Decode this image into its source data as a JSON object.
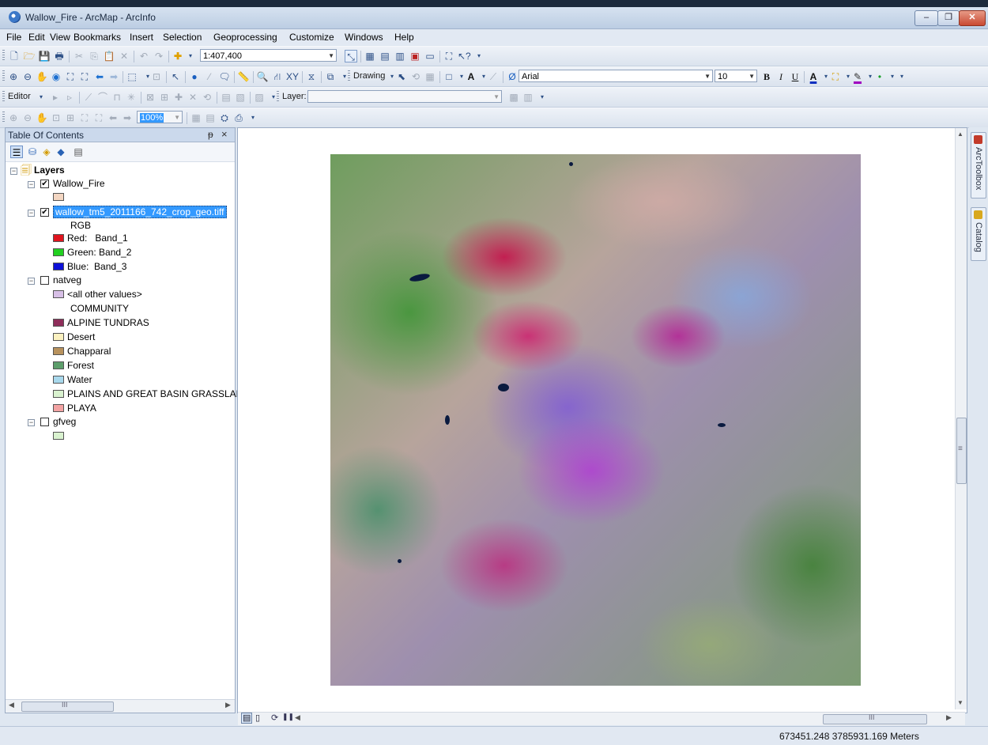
{
  "window": {
    "title": "Wallow_Fire - ArcMap - ArcInfo",
    "controls": {
      "minimize": "–",
      "maximize": "❐",
      "close": "✕"
    }
  },
  "menu": [
    "File",
    "Edit",
    "View",
    "Bookmarks",
    "Insert",
    "Selection",
    "Geoprocessing",
    "Customize",
    "Windows",
    "Help"
  ],
  "toolbar": {
    "scale": "1:407,400",
    "drawing_label": "Drawing",
    "font_name": "Arial",
    "font_size": "10",
    "bold": "B",
    "italic": "I",
    "underline": "U",
    "text_color_glyph": "A",
    "editor_label": "Editor",
    "layer_label": "Layer:",
    "layer_value": "",
    "zoom_percent": "100%"
  },
  "toc": {
    "title": "Table Of Contents",
    "pin": "ᵽ",
    "close": "×",
    "root_label": "Layers",
    "layers": [
      {
        "name": "Wallow_Fire",
        "checked": true,
        "legend": [
          {
            "label": "",
            "color": "#f3d6c2"
          }
        ]
      },
      {
        "name": "wallow_tm5_2011166_742_crop_geo.tiff",
        "checked": true,
        "selected": true,
        "header": "RGB",
        "legend": [
          {
            "label": "Red:   Band_1",
            "color": "#e0141e"
          },
          {
            "label": "Green: Band_2",
            "color": "#22d020"
          },
          {
            "label": "Blue:  Band_3",
            "color": "#0d10d8"
          }
        ]
      },
      {
        "name": "natveg",
        "checked": false,
        "legend": [
          {
            "label": "<all other values>",
            "color": "#d7bfe6"
          },
          {
            "label": "COMMUNITY",
            "color": ""
          },
          {
            "label": "ALPINE TUNDRAS",
            "color": "#8e2d5a"
          },
          {
            "label": "Desert",
            "color": "#fbf1c0"
          },
          {
            "label": "Chapparal",
            "color": "#b8925d"
          },
          {
            "label": "Forest",
            "color": "#5d9e6b"
          },
          {
            "label": "Water",
            "color": "#a8d8ec"
          },
          {
            "label": "PLAINS AND GREAT BASIN GRASSLAND;",
            "color": "#d9f2cf"
          },
          {
            "label": "PLAYA",
            "color": "#f3a3a3"
          }
        ]
      },
      {
        "name": "gfveg",
        "checked": false,
        "legend": [
          {
            "label": "",
            "color": "#d9f2cf"
          }
        ]
      }
    ],
    "hscroll_thumb_text": "III"
  },
  "map": {
    "hscroll_thumb_text": "III",
    "vscroll_thumb_text": "≡"
  },
  "dock": {
    "tabs": [
      "ArcToolbox",
      "Catalog"
    ]
  },
  "status": {
    "coordinates": "673451.248  3785931.169 Meters"
  },
  "icons": {
    "new": "new-document-icon",
    "open": "open-folder-icon",
    "save": "save-icon",
    "print": "print-icon",
    "cut": "cut-icon",
    "copy": "copy-icon",
    "paste": "paste-icon",
    "delete": "delete-icon",
    "undo": "undo-icon",
    "redo": "redo-icon",
    "add_data": "add-data-icon",
    "zoom_in": "zoom-in-icon",
    "zoom_out": "zoom-out-icon",
    "pan": "pan-icon",
    "full_extent": "full-extent-icon",
    "identify": "identify-icon",
    "find": "find-icon"
  }
}
